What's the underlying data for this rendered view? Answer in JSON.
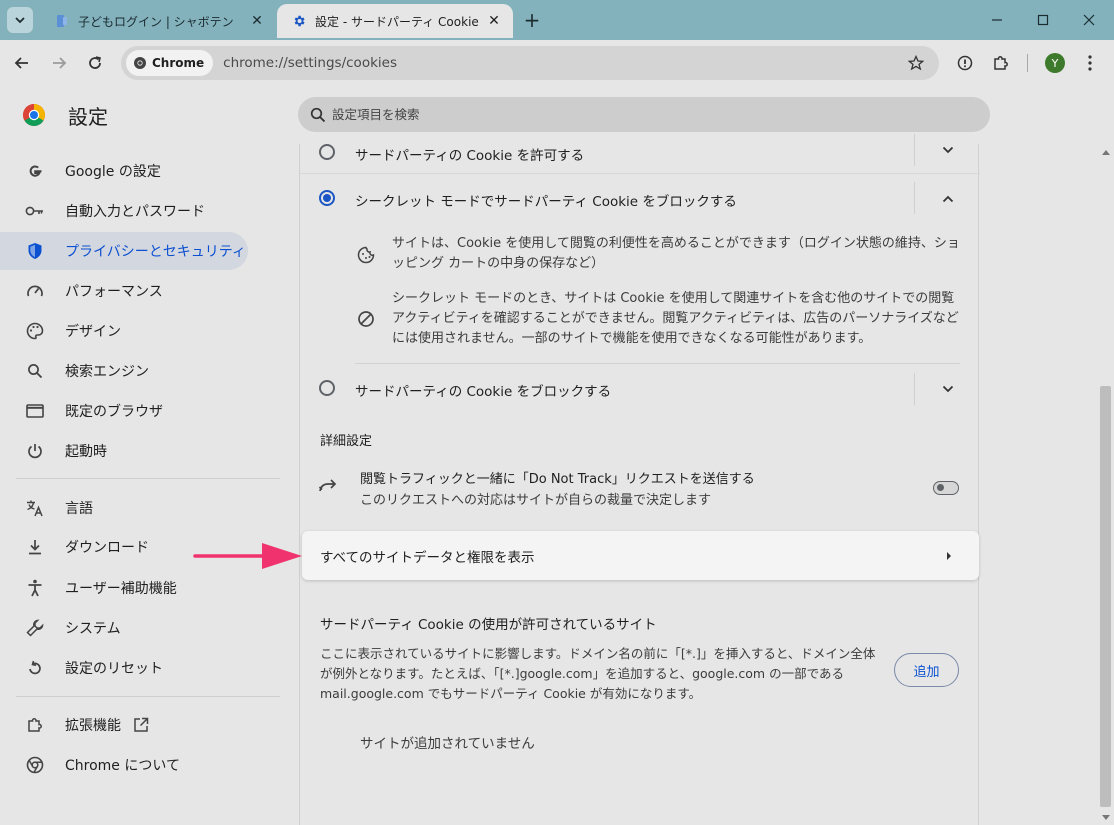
{
  "window": {
    "tabs": [
      {
        "title": "子どもログイン | シャボテン",
        "active": false
      },
      {
        "title": "設定 - サードパーティ Cookie",
        "active": true
      }
    ],
    "new_tab_symbol": "+",
    "controls": {
      "minimize": "—",
      "maximize": "☐",
      "close": "✕"
    }
  },
  "toolbar": {
    "chip_label": "Chrome",
    "url": "chrome://settings/cookies",
    "avatar_letter": "Y"
  },
  "header": {
    "title": "設定",
    "search_placeholder": "設定項目を検索"
  },
  "sidebar": {
    "items": [
      {
        "label": "Google の設定",
        "icon": "google-g-icon"
      },
      {
        "label": "自動入力とパスワード",
        "icon": "key-icon"
      },
      {
        "label": "プライバシーとセキュリティ",
        "icon": "shield-icon",
        "selected": true
      },
      {
        "label": "パフォーマンス",
        "icon": "speedometer-icon"
      },
      {
        "label": "デザイン",
        "icon": "palette-icon"
      },
      {
        "label": "検索エンジン",
        "icon": "search-icon"
      },
      {
        "label": "既定のブラウザ",
        "icon": "browser-window-icon"
      },
      {
        "label": "起動時",
        "icon": "power-icon"
      },
      {
        "label": "言語",
        "icon": "translate-icon"
      },
      {
        "label": "ダウンロード",
        "icon": "download-icon"
      },
      {
        "label": "ユーザー補助機能",
        "icon": "accessibility-icon"
      },
      {
        "label": "システム",
        "icon": "wrench-icon"
      },
      {
        "label": "設定のリセット",
        "icon": "reset-icon"
      },
      {
        "label": "拡張機能",
        "icon": "puzzle-icon"
      },
      {
        "label": "Chrome について",
        "icon": "chrome-icon"
      }
    ]
  },
  "main": {
    "options": [
      {
        "label": "サードパーティの Cookie を許可する",
        "checked": false,
        "expanded": false
      },
      {
        "label": "シークレット モードでサードパーティ Cookie をブロックする",
        "checked": true,
        "expanded": true
      },
      {
        "label": "サードパーティの Cookie をブロックする",
        "checked": false,
        "expanded": false
      }
    ],
    "expanded_desc": [
      {
        "text": "サイトは、Cookie を使用して閲覧の利便性を高めることができます（ログイン状態の維持、ショッピング カートの中身の保存など）",
        "icon": "cookie-icon"
      },
      {
        "text": "シークレット モードのとき、サイトは Cookie を使用して関連サイトを含む他のサイトでの閲覧アクティビティを確認することができません。閲覧アクティビティは、広告のパーソナライズなどには使用されません。一部のサイトで機能を使用できなくなる可能性があります。",
        "icon": "block-icon"
      }
    ],
    "advanced_title": "詳細設定",
    "dnt": {
      "line1": "閲覧トラフィックと一緒に「Do Not Track」リクエストを送信する",
      "line2": "このリクエストへの対応はサイトが自らの裁量で決定します",
      "enabled": false
    },
    "all_site_data_label": "すべてのサイトデータと権限を表示",
    "allowed_sites": {
      "title": "サードパーティ Cookie の使用が許可されているサイト",
      "desc": "ここに表示されているサイトに影響します。ドメイン名の前に「[*.]」を挿入すると、ドメイン全体が例外となります。たとえば、「[*.]google.com」を追加すると、google.com の一部である mail.google.com でもサードパーティ Cookie が有効になります。",
      "add_label": "追加",
      "empty_text": "サイトが追加されていません"
    }
  },
  "colors": {
    "accent": "#0b50d0",
    "tabbar": "#83b2bd",
    "annotation_arrow": "#f0326e"
  }
}
